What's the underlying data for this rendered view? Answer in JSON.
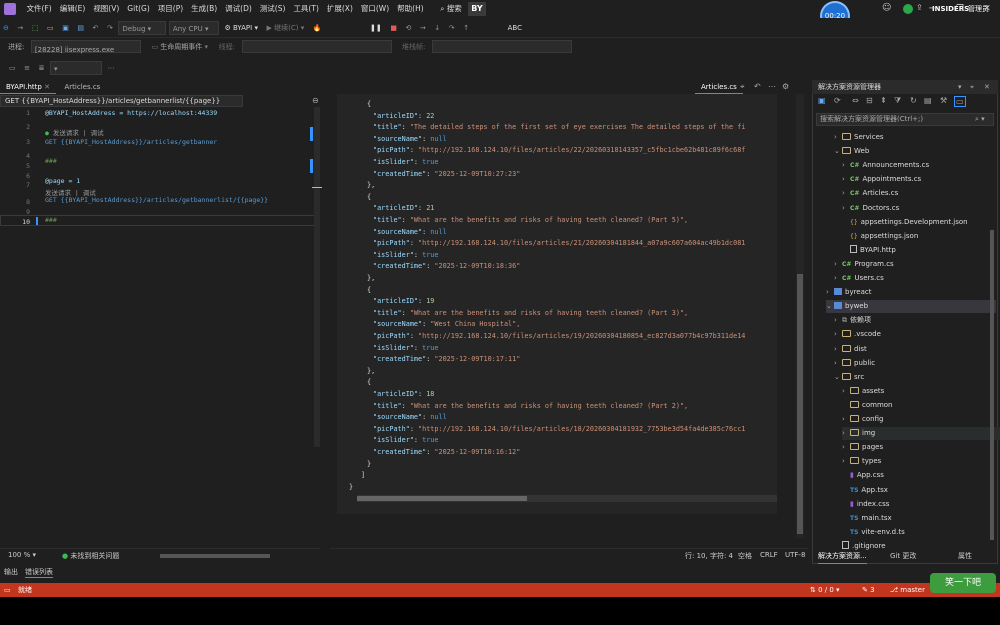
{
  "menubar": {
    "items": [
      "文件(F)",
      "编辑(E)",
      "视图(V)",
      "Git(G)",
      "项目(P)",
      "生成(B)",
      "调试(D)",
      "测试(S)",
      "工具(T)",
      "扩展(X)",
      "窗口(W)",
      "帮助(H)"
    ],
    "search": "搜索",
    "solution_badge": "BY",
    "timer": "00:20",
    "insiders": "INSIDERS",
    "admin": "管理员"
  },
  "toolbar": {
    "config": "Debug",
    "platform": "Any CPU",
    "startup": "BYAPI",
    "continue": "继续(C)",
    "spell": "ABC"
  },
  "locbar": {
    "process_label": "进程:",
    "process": "[28228] iisexpress.exe",
    "lifecycle": "生命周期事件",
    "thread_label": "线程:",
    "stack_label": "堆栈帧:"
  },
  "left_editor": {
    "tabs": [
      "BYAPI.http",
      "Articles.cs"
    ],
    "nav": "GET {{BYAPI_HostAddress}}/articles/getbannerlist/{{page}}",
    "codelens1": "发送请求 | 调试",
    "codelens2": "发送请求 | 调试",
    "line1": "@BYAPI_HostAddress = https://localhost:44339",
    "line3": "GET {{BYAPI_HostAddress}}/articles/getbanner",
    "line5": "###",
    "line7": "@page = 1",
    "line8": "GET {{BYAPI_HostAddress}}/articles/getbannerlist/{{page}}",
    "line10": "###",
    "zoom": "100 %",
    "issues": "未找到相关问题"
  },
  "right_editor": {
    "tab": "Articles.cs",
    "articles": [
      {
        "articleID": "22",
        "title": "\"The detailed steps of the first set of eye exercises The detailed steps of the fi",
        "sourceName": "null",
        "picPath": "\"http://192.168.124.10/files/articles/22/20260318143357_c5fbc1cbe62b481c89f6c68f",
        "isSlider": "true",
        "createdTime": "\"2025-12-09T10:27:23\""
      },
      {
        "articleID": "21",
        "title": "\"What are the benefits and risks of having teeth cleaned? (Part 5)\",",
        "sourceName": "null",
        "picPath": "\"http://192.168.124.10/files/articles/21/20260304181844_a07a9c607a604ac49b1dc081",
        "isSlider": "true",
        "createdTime": "\"2025-12-09T10:18:36\""
      },
      {
        "articleID": "19",
        "title": "\"What are the benefits and risks of having teeth cleaned? (Part 3)\",",
        "sourceName": "\"West China Hospital\",",
        "picPath": "\"http://192.168.124.10/files/articles/19/20260304180854_ec827d3a077b4c97b311de14",
        "isSlider": "true",
        "createdTime": "\"2025-12-09T10:17:11\""
      },
      {
        "articleID": "18",
        "title": "\"What are the benefits and risks of having teeth cleaned? (Part 2)\",",
        "sourceName": "null",
        "picPath": "\"http://192.168.124.10/files/articles/18/20260304181932_7753be3d54fa4de385c76cc1",
        "isSlider": "true",
        "createdTime": "\"2025-12-09T10:16:12\""
      }
    ],
    "status_pos": "行: 10, 字符: 4",
    "status_space": "空格",
    "status_eol": "CRLF",
    "status_enc": "UTF-8"
  },
  "output_tabs": [
    "输出",
    "错误列表"
  ],
  "statusbar": {
    "ready": "就绪",
    "changes": "0 / 0",
    "edits": "3",
    "branch": "master"
  },
  "solution_explorer": {
    "title": "解决方案资源管理器",
    "search_placeholder": "搜索解决方案资源管理器(Ctrl+;)",
    "items": [
      {
        "label": "Services",
        "kind": "folder"
      },
      {
        "label": "Web",
        "kind": "folder"
      },
      {
        "label": "Announcements.cs",
        "kind": "cs"
      },
      {
        "label": "Appointments.cs",
        "kind": "cs"
      },
      {
        "label": "Articles.cs",
        "kind": "cs"
      },
      {
        "label": "Doctors.cs",
        "kind": "cs"
      },
      {
        "label": "appsettings.Development.json",
        "kind": "json"
      },
      {
        "label": "appsettings.json",
        "kind": "json"
      },
      {
        "label": "BYAPI.http",
        "kind": "file"
      },
      {
        "label": "Program.cs",
        "kind": "cs"
      },
      {
        "label": "Users.cs",
        "kind": "cs"
      },
      {
        "label": "byreact",
        "kind": "proj"
      },
      {
        "label": "byweb",
        "kind": "proj"
      },
      {
        "label": "依赖项",
        "kind": "dep"
      },
      {
        "label": ".vscode",
        "kind": "folder"
      },
      {
        "label": "dist",
        "kind": "folder"
      },
      {
        "label": "public",
        "kind": "folder"
      },
      {
        "label": "src",
        "kind": "folder"
      },
      {
        "label": "assets",
        "kind": "folder"
      },
      {
        "label": "common",
        "kind": "folder"
      },
      {
        "label": "config",
        "kind": "folder"
      },
      {
        "label": "img",
        "kind": "folder"
      },
      {
        "label": "pages",
        "kind": "folder"
      },
      {
        "label": "types",
        "kind": "folder"
      },
      {
        "label": "App.css",
        "kind": "css"
      },
      {
        "label": "App.tsx",
        "kind": "ts"
      },
      {
        "label": "index.css",
        "kind": "css"
      },
      {
        "label": "main.tsx",
        "kind": "ts"
      },
      {
        "label": "vite-env.d.ts",
        "kind": "ts"
      },
      {
        "label": ".gitignore",
        "kind": "file"
      }
    ],
    "tabs": [
      "解决方案资源...",
      "Git 更改",
      "属性"
    ]
  },
  "watermark": "笑一下吧"
}
